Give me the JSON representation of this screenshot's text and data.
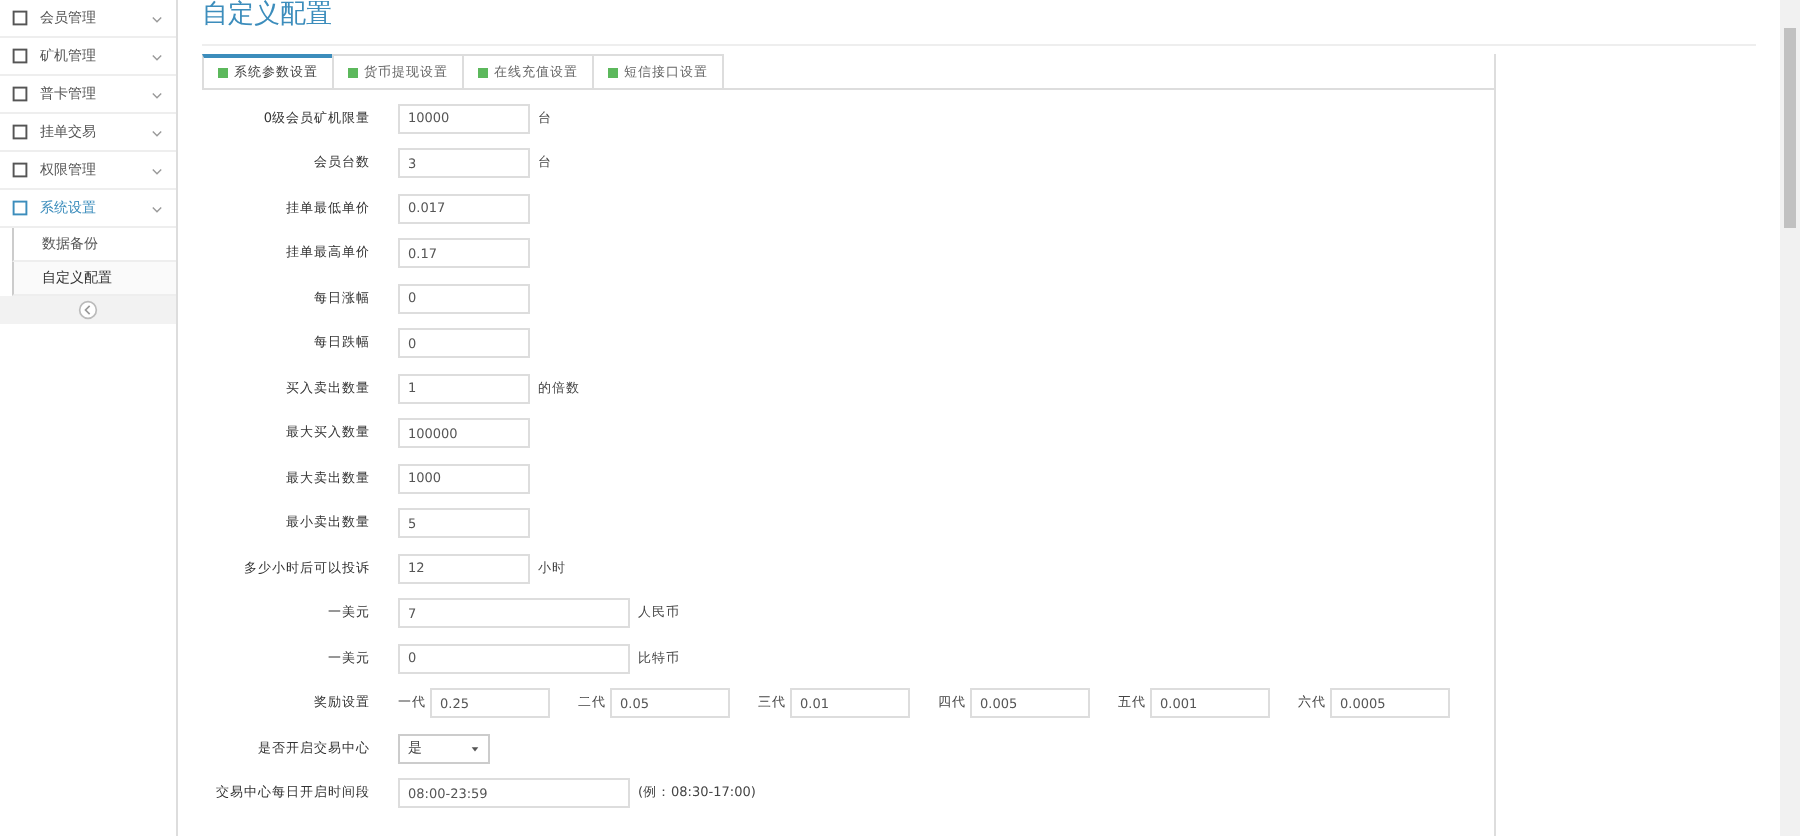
{
  "sidebar": {
    "items": [
      {
        "label": "会员管理",
        "selected": false
      },
      {
        "label": "矿机管理",
        "selected": false
      },
      {
        "label": "普卡管理",
        "selected": false
      },
      {
        "label": "挂单交易",
        "selected": false
      },
      {
        "label": "权限管理",
        "selected": false
      },
      {
        "label": "系统设置",
        "selected": true,
        "children": [
          {
            "label": "数据备份",
            "selected": false
          },
          {
            "label": "自定义配置",
            "selected": true
          }
        ]
      }
    ]
  },
  "page_title": "自定义配置",
  "tabs": [
    {
      "label": "系统参数设置",
      "selected": true
    },
    {
      "label": "货币提现设置",
      "selected": false
    },
    {
      "label": "在线充值设置",
      "selected": false
    },
    {
      "label": "短信接口设置",
      "selected": false
    }
  ],
  "form": [
    {
      "kind": "input",
      "label": "0级会员矿机限量",
      "value": "10000",
      "unit": "台"
    },
    {
      "kind": "input",
      "label": "会员台数",
      "value": "3",
      "unit": "台"
    },
    {
      "kind": "input",
      "label": "挂单最低单价",
      "value": "0.017"
    },
    {
      "kind": "input",
      "label": "挂单最高单价",
      "value": "0.17"
    },
    {
      "kind": "input",
      "label": "每日涨幅",
      "value": "0"
    },
    {
      "kind": "input",
      "label": "每日跌幅",
      "value": "0"
    },
    {
      "kind": "input",
      "label": "买入卖出数量",
      "value": "1",
      "unit": "的倍数"
    },
    {
      "kind": "input",
      "label": "最大买入数量",
      "value": "100000"
    },
    {
      "kind": "input",
      "label": "最大卖出数量",
      "value": "1000"
    },
    {
      "kind": "input",
      "label": "最小卖出数量",
      "value": "5"
    },
    {
      "kind": "input",
      "label": "多少小时后可以投诉",
      "value": "12",
      "unit": "小时"
    },
    {
      "kind": "wide",
      "label": "一美元",
      "value": "7",
      "unit": "人民币"
    },
    {
      "kind": "wide",
      "label": "一美元",
      "value": "0",
      "unit": "比特币"
    },
    {
      "kind": "reward",
      "label": "奖励设置",
      "levels": [
        {
          "label": "一代",
          "value": "0.25"
        },
        {
          "label": "二代",
          "value": "0.05"
        },
        {
          "label": "三代",
          "value": "0.01"
        },
        {
          "label": "四代",
          "value": "0.005"
        },
        {
          "label": "五代",
          "value": "0.001"
        },
        {
          "label": "六代",
          "value": "0.0005"
        }
      ]
    },
    {
      "kind": "select",
      "label": "是否开启交易中心",
      "value": "是"
    },
    {
      "kind": "wide",
      "label": "交易中心每日开启时间段",
      "value": "08:00-23:59",
      "unit": "(例：08:30-17:00)"
    }
  ]
}
